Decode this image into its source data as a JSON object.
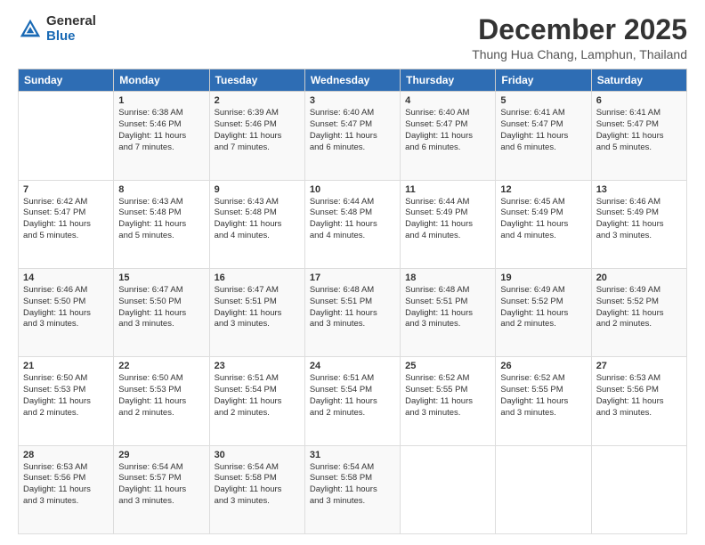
{
  "logo": {
    "general": "General",
    "blue": "Blue"
  },
  "title": "December 2025",
  "subtitle": "Thung Hua Chang, Lamphun, Thailand",
  "weekdays": [
    "Sunday",
    "Monday",
    "Tuesday",
    "Wednesday",
    "Thursday",
    "Friday",
    "Saturday"
  ],
  "weeks": [
    [
      {
        "day": "",
        "info": ""
      },
      {
        "day": "1",
        "info": "Sunrise: 6:38 AM\nSunset: 5:46 PM\nDaylight: 11 hours\nand 7 minutes."
      },
      {
        "day": "2",
        "info": "Sunrise: 6:39 AM\nSunset: 5:46 PM\nDaylight: 11 hours\nand 7 minutes."
      },
      {
        "day": "3",
        "info": "Sunrise: 6:40 AM\nSunset: 5:47 PM\nDaylight: 11 hours\nand 6 minutes."
      },
      {
        "day": "4",
        "info": "Sunrise: 6:40 AM\nSunset: 5:47 PM\nDaylight: 11 hours\nand 6 minutes."
      },
      {
        "day": "5",
        "info": "Sunrise: 6:41 AM\nSunset: 5:47 PM\nDaylight: 11 hours\nand 6 minutes."
      },
      {
        "day": "6",
        "info": "Sunrise: 6:41 AM\nSunset: 5:47 PM\nDaylight: 11 hours\nand 5 minutes."
      }
    ],
    [
      {
        "day": "7",
        "info": "Sunrise: 6:42 AM\nSunset: 5:47 PM\nDaylight: 11 hours\nand 5 minutes."
      },
      {
        "day": "8",
        "info": "Sunrise: 6:43 AM\nSunset: 5:48 PM\nDaylight: 11 hours\nand 5 minutes."
      },
      {
        "day": "9",
        "info": "Sunrise: 6:43 AM\nSunset: 5:48 PM\nDaylight: 11 hours\nand 4 minutes."
      },
      {
        "day": "10",
        "info": "Sunrise: 6:44 AM\nSunset: 5:48 PM\nDaylight: 11 hours\nand 4 minutes."
      },
      {
        "day": "11",
        "info": "Sunrise: 6:44 AM\nSunset: 5:49 PM\nDaylight: 11 hours\nand 4 minutes."
      },
      {
        "day": "12",
        "info": "Sunrise: 6:45 AM\nSunset: 5:49 PM\nDaylight: 11 hours\nand 4 minutes."
      },
      {
        "day": "13",
        "info": "Sunrise: 6:46 AM\nSunset: 5:49 PM\nDaylight: 11 hours\nand 3 minutes."
      }
    ],
    [
      {
        "day": "14",
        "info": "Sunrise: 6:46 AM\nSunset: 5:50 PM\nDaylight: 11 hours\nand 3 minutes."
      },
      {
        "day": "15",
        "info": "Sunrise: 6:47 AM\nSunset: 5:50 PM\nDaylight: 11 hours\nand 3 minutes."
      },
      {
        "day": "16",
        "info": "Sunrise: 6:47 AM\nSunset: 5:51 PM\nDaylight: 11 hours\nand 3 minutes."
      },
      {
        "day": "17",
        "info": "Sunrise: 6:48 AM\nSunset: 5:51 PM\nDaylight: 11 hours\nand 3 minutes."
      },
      {
        "day": "18",
        "info": "Sunrise: 6:48 AM\nSunset: 5:51 PM\nDaylight: 11 hours\nand 3 minutes."
      },
      {
        "day": "19",
        "info": "Sunrise: 6:49 AM\nSunset: 5:52 PM\nDaylight: 11 hours\nand 2 minutes."
      },
      {
        "day": "20",
        "info": "Sunrise: 6:49 AM\nSunset: 5:52 PM\nDaylight: 11 hours\nand 2 minutes."
      }
    ],
    [
      {
        "day": "21",
        "info": "Sunrise: 6:50 AM\nSunset: 5:53 PM\nDaylight: 11 hours\nand 2 minutes."
      },
      {
        "day": "22",
        "info": "Sunrise: 6:50 AM\nSunset: 5:53 PM\nDaylight: 11 hours\nand 2 minutes."
      },
      {
        "day": "23",
        "info": "Sunrise: 6:51 AM\nSunset: 5:54 PM\nDaylight: 11 hours\nand 2 minutes."
      },
      {
        "day": "24",
        "info": "Sunrise: 6:51 AM\nSunset: 5:54 PM\nDaylight: 11 hours\nand 2 minutes."
      },
      {
        "day": "25",
        "info": "Sunrise: 6:52 AM\nSunset: 5:55 PM\nDaylight: 11 hours\nand 3 minutes."
      },
      {
        "day": "26",
        "info": "Sunrise: 6:52 AM\nSunset: 5:55 PM\nDaylight: 11 hours\nand 3 minutes."
      },
      {
        "day": "27",
        "info": "Sunrise: 6:53 AM\nSunset: 5:56 PM\nDaylight: 11 hours\nand 3 minutes."
      }
    ],
    [
      {
        "day": "28",
        "info": "Sunrise: 6:53 AM\nSunset: 5:56 PM\nDaylight: 11 hours\nand 3 minutes."
      },
      {
        "day": "29",
        "info": "Sunrise: 6:54 AM\nSunset: 5:57 PM\nDaylight: 11 hours\nand 3 minutes."
      },
      {
        "day": "30",
        "info": "Sunrise: 6:54 AM\nSunset: 5:58 PM\nDaylight: 11 hours\nand 3 minutes."
      },
      {
        "day": "31",
        "info": "Sunrise: 6:54 AM\nSunset: 5:58 PM\nDaylight: 11 hours\nand 3 minutes."
      },
      {
        "day": "",
        "info": ""
      },
      {
        "day": "",
        "info": ""
      },
      {
        "day": "",
        "info": ""
      }
    ]
  ]
}
